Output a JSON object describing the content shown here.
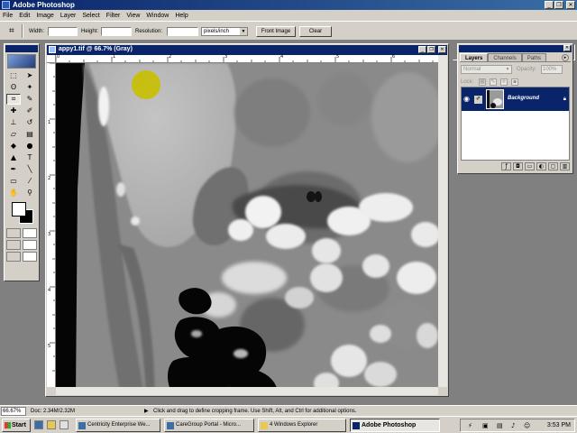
{
  "app": {
    "title": "Adobe Photoshop",
    "window_buttons": [
      "_",
      "❐",
      "✕"
    ]
  },
  "menu": [
    "File",
    "Edit",
    "Image",
    "Layer",
    "Select",
    "Filter",
    "View",
    "Window",
    "Help"
  ],
  "options_bar": {
    "width_label": "Width:",
    "width_value": "",
    "height_label": "Height:",
    "height_value": "",
    "resolution_label": "Resolution:",
    "resolution_value": "",
    "resolution_unit": "pixels/inch",
    "front_image_button": "Front Image",
    "clear_button": "Clear"
  },
  "toolbox": {
    "tools": [
      "marquee-tool",
      "move-tool",
      "lasso-tool",
      "magic-wand-tool",
      "crop-tool",
      "slice-tool",
      "healing-brush-tool",
      "brush-tool",
      "clone-stamp-tool",
      "history-brush-tool",
      "eraser-tool",
      "gradient-tool",
      "blur-tool",
      "dodge-tool",
      "path-selection-tool",
      "type-tool",
      "pen-tool",
      "shape-tool",
      "notes-tool",
      "eyedropper-tool",
      "hand-tool",
      "zoom-tool"
    ],
    "active_tool": "crop-tool",
    "foreground_color": "#ffffff",
    "background_color": "#000000"
  },
  "document": {
    "title": "appy1.tif @ 66.7% (Gray)",
    "ruler_top_labels": [
      "0",
      "1",
      "2",
      "3",
      "4",
      "5",
      "6"
    ],
    "ruler_left_labels": [
      "1",
      "2",
      "3",
      "4",
      "5"
    ],
    "window_buttons": [
      "_",
      "❐",
      "✕"
    ]
  },
  "layers_panel": {
    "tabs": [
      "Layers",
      "Channels",
      "Paths"
    ],
    "active_tab": "Layers",
    "blend_mode": "Normal",
    "opacity_label": "Opacity:",
    "opacity_value": "100%",
    "lock_label": "Lock:",
    "layers": [
      {
        "name": "Background",
        "visible": true,
        "locked": true,
        "selected": true
      }
    ]
  },
  "status_bar": {
    "zoom": "66.67%",
    "doc_info": "Doc: 2.34M/2.32M",
    "hint": "Click and drag to define cropping frame. Use Shift, Alt, and Ctrl for additional options."
  },
  "taskbar": {
    "start_label": "Start",
    "items": [
      {
        "label": "Centricity Enterprise We...",
        "active": false
      },
      {
        "label": "CareGroup Portal - Micro...",
        "active": false
      },
      {
        "label": "4 Windows Explorer",
        "active": false
      },
      {
        "label": "Adobe Photoshop",
        "active": true
      }
    ],
    "clock": "3:53 PM"
  },
  "colors": {
    "titlebar": "#0a246a",
    "chrome": "#d4d0c8",
    "selection": "#0a246a",
    "cursor_highlight": "#c8c000"
  }
}
